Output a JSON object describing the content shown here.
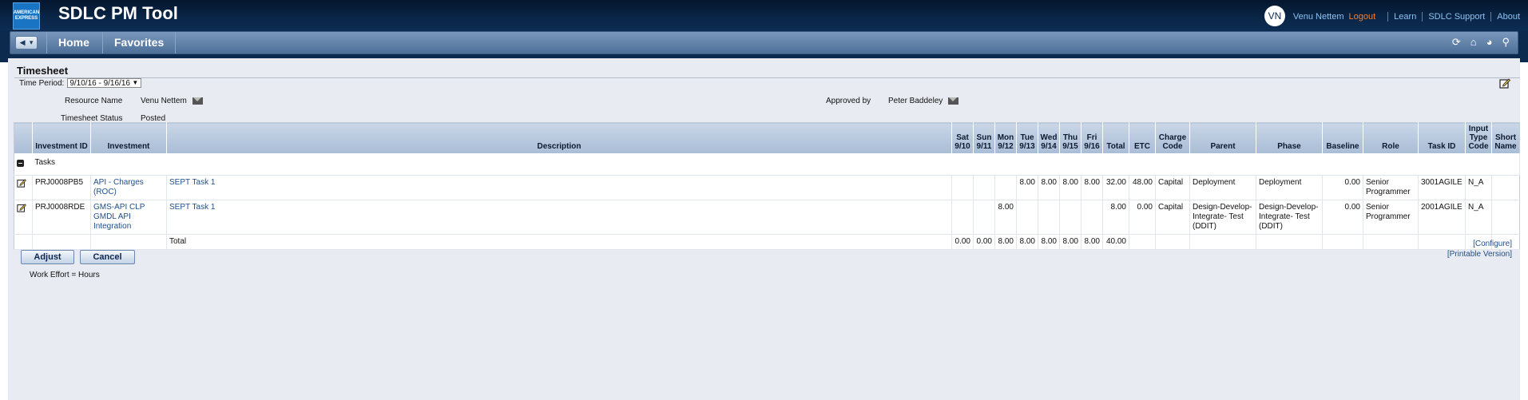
{
  "header": {
    "logo_text": "AMERICAN EXPRESS",
    "app_title": "SDLC PM Tool",
    "avatar_initials": "VN",
    "user_name": "Venu Nettem",
    "links": [
      "Logout",
      "Learn",
      "SDLC Support",
      "About"
    ]
  },
  "nav": {
    "items": [
      "Home",
      "Favorites"
    ],
    "icons": [
      "refresh-icon",
      "home-icon",
      "help-icon",
      "search-icon"
    ]
  },
  "page": {
    "title": "Timesheet",
    "time_period_label": "Time Period:",
    "time_period_value": "9/10/16 - 9/16/16",
    "resource_name_label": "Resource Name",
    "resource_name_value": "Venu Nettem",
    "status_label": "Timesheet Status",
    "status_value": "Posted",
    "approved_by_label": "Approved by",
    "approved_by_value": "Peter Baddeley"
  },
  "table": {
    "columns": [
      "",
      "Investment ID",
      "Investment",
      "Description",
      "Sat 9/10",
      "Sun 9/11",
      "Mon 9/12",
      "Tue 9/13",
      "Wed 9/14",
      "Thu 9/15",
      "Fri 9/16",
      "Total",
      "ETC",
      "Charge Code",
      "Parent",
      "Phase",
      "Baseline",
      "Role",
      "Task ID",
      "Input Type Code",
      "Short Name"
    ],
    "group_label": "Tasks",
    "rows": [
      [
        "",
        "PRJ0008PB5",
        "API - Charges (ROC)",
        "SEPT Task 1",
        "",
        "",
        "",
        "8.00",
        "8.00",
        "8.00",
        "8.00",
        "32.00",
        "48.00",
        "Capital",
        "Deployment",
        "Deployment",
        "0.00",
        "Senior Programmer",
        "3001AGILE",
        "N_A",
        ""
      ],
      [
        "",
        "PRJ0008RDE",
        "GMS-API CLP GMDL API Integration",
        "SEPT Task 1",
        "",
        "",
        "8.00",
        "",
        "",
        "",
        "",
        "8.00",
        "0.00",
        "Capital",
        "Design-Develop-Integrate- Test (DDIT)",
        "Design-Develop-Integrate- Test (DDIT)",
        "0.00",
        "Senior Programmer",
        "2001AGILE",
        "N_A",
        ""
      ]
    ],
    "total_row": [
      "",
      "",
      "",
      "Total",
      "0.00",
      "0.00",
      "8.00",
      "8.00",
      "8.00",
      "8.00",
      "8.00",
      "40.00",
      "",
      "",
      "",
      "",
      "",
      "",
      "",
      "",
      ""
    ]
  },
  "links": {
    "configure": "[Configure]",
    "printable": "[Printable Version]"
  },
  "buttons": {
    "adjust": "Adjust",
    "cancel": "Cancel"
  },
  "footer_note": "Work Effort = Hours"
}
